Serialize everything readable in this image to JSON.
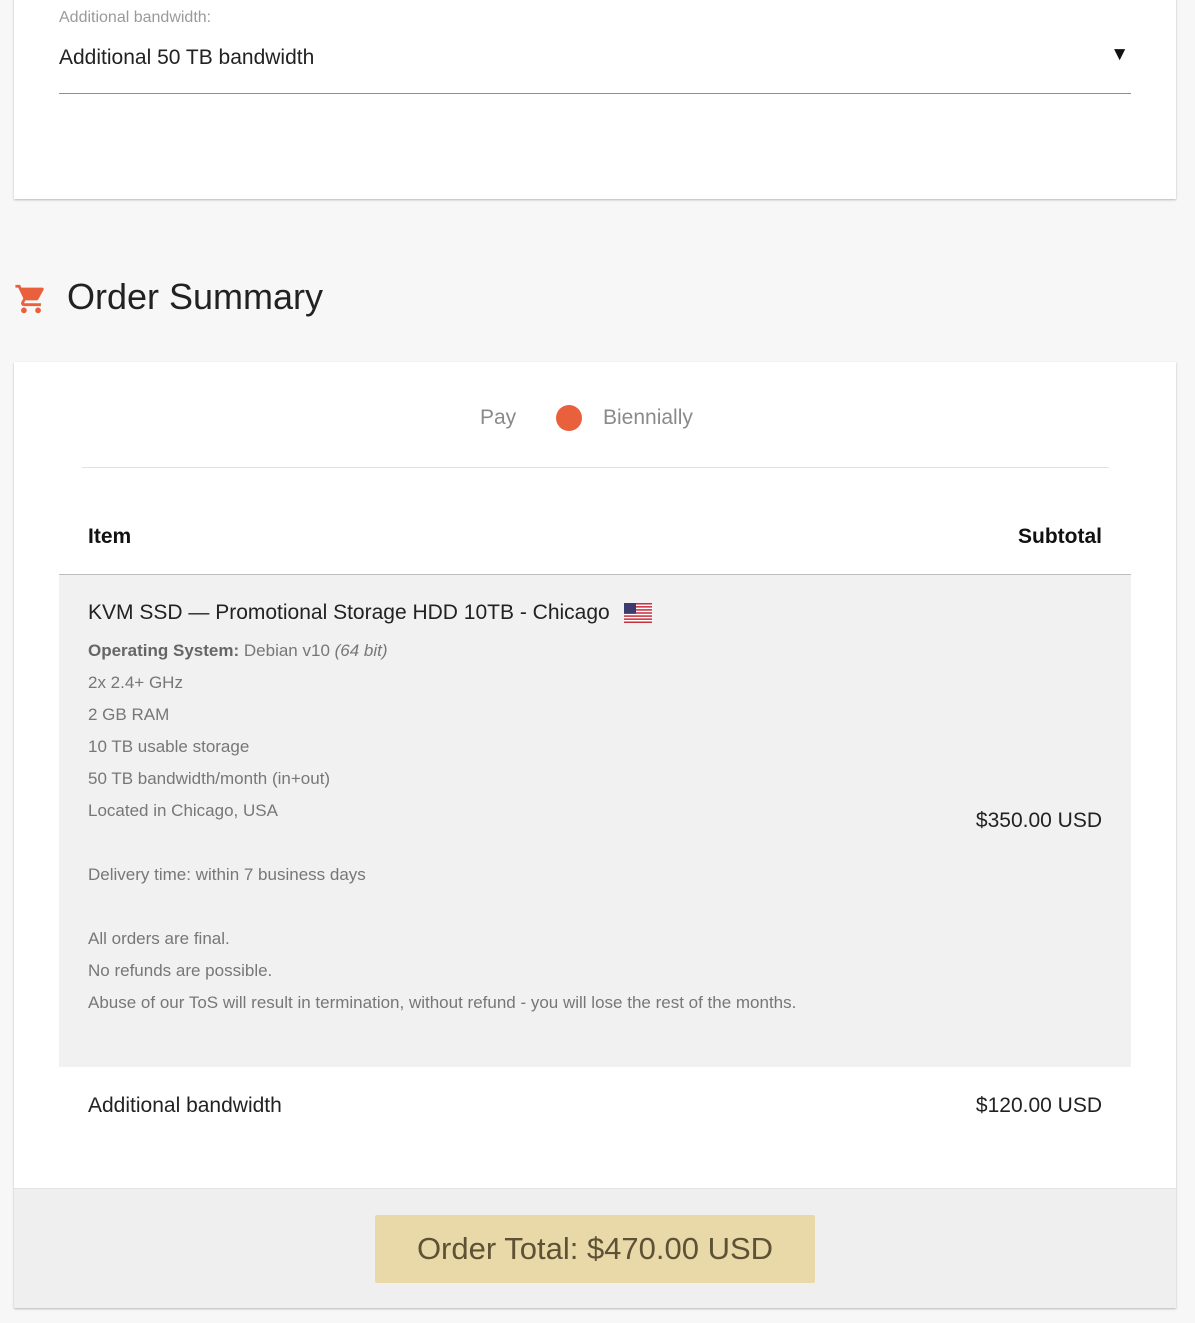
{
  "config": {
    "additional_bandwidth_label": "Additional bandwidth:",
    "additional_bandwidth_value": "Additional 50 TB bandwidth"
  },
  "summary": {
    "title": "Order Summary",
    "billing": {
      "pay_label": "Pay",
      "period": "Biennially"
    },
    "columns": {
      "item": "Item",
      "subtotal": "Subtotal"
    },
    "product": {
      "name": "KVM SSD — Promotional Storage HDD 10TB - Chicago",
      "os_label": "Operating System:",
      "os_value": "Debian v10",
      "os_arch": "(64 bit)",
      "specs": [
        "2x 2.4+ GHz",
        "2 GB RAM",
        "10 TB usable storage",
        "50 TB bandwidth/month (in+out)",
        "Located in Chicago, USA"
      ],
      "delivery": "Delivery time: within 7 business days",
      "terms": [
        "All orders are final.",
        "No refunds are possible.",
        "Abuse of our ToS will result in termination, without refund - you will lose the rest of the months."
      ],
      "price": "$350.00 USD"
    },
    "addon": {
      "name": "Additional bandwidth",
      "price": "$120.00 USD"
    },
    "total": "Order Total: $470.00 USD"
  },
  "colors": {
    "accent": "#e8603c",
    "total_button": "#ead9a8",
    "total_text": "#5e5236"
  },
  "icons": {
    "cart": "shopping-cart-icon",
    "flag": "us-flag-icon",
    "dropdown": "caret-down-icon"
  }
}
